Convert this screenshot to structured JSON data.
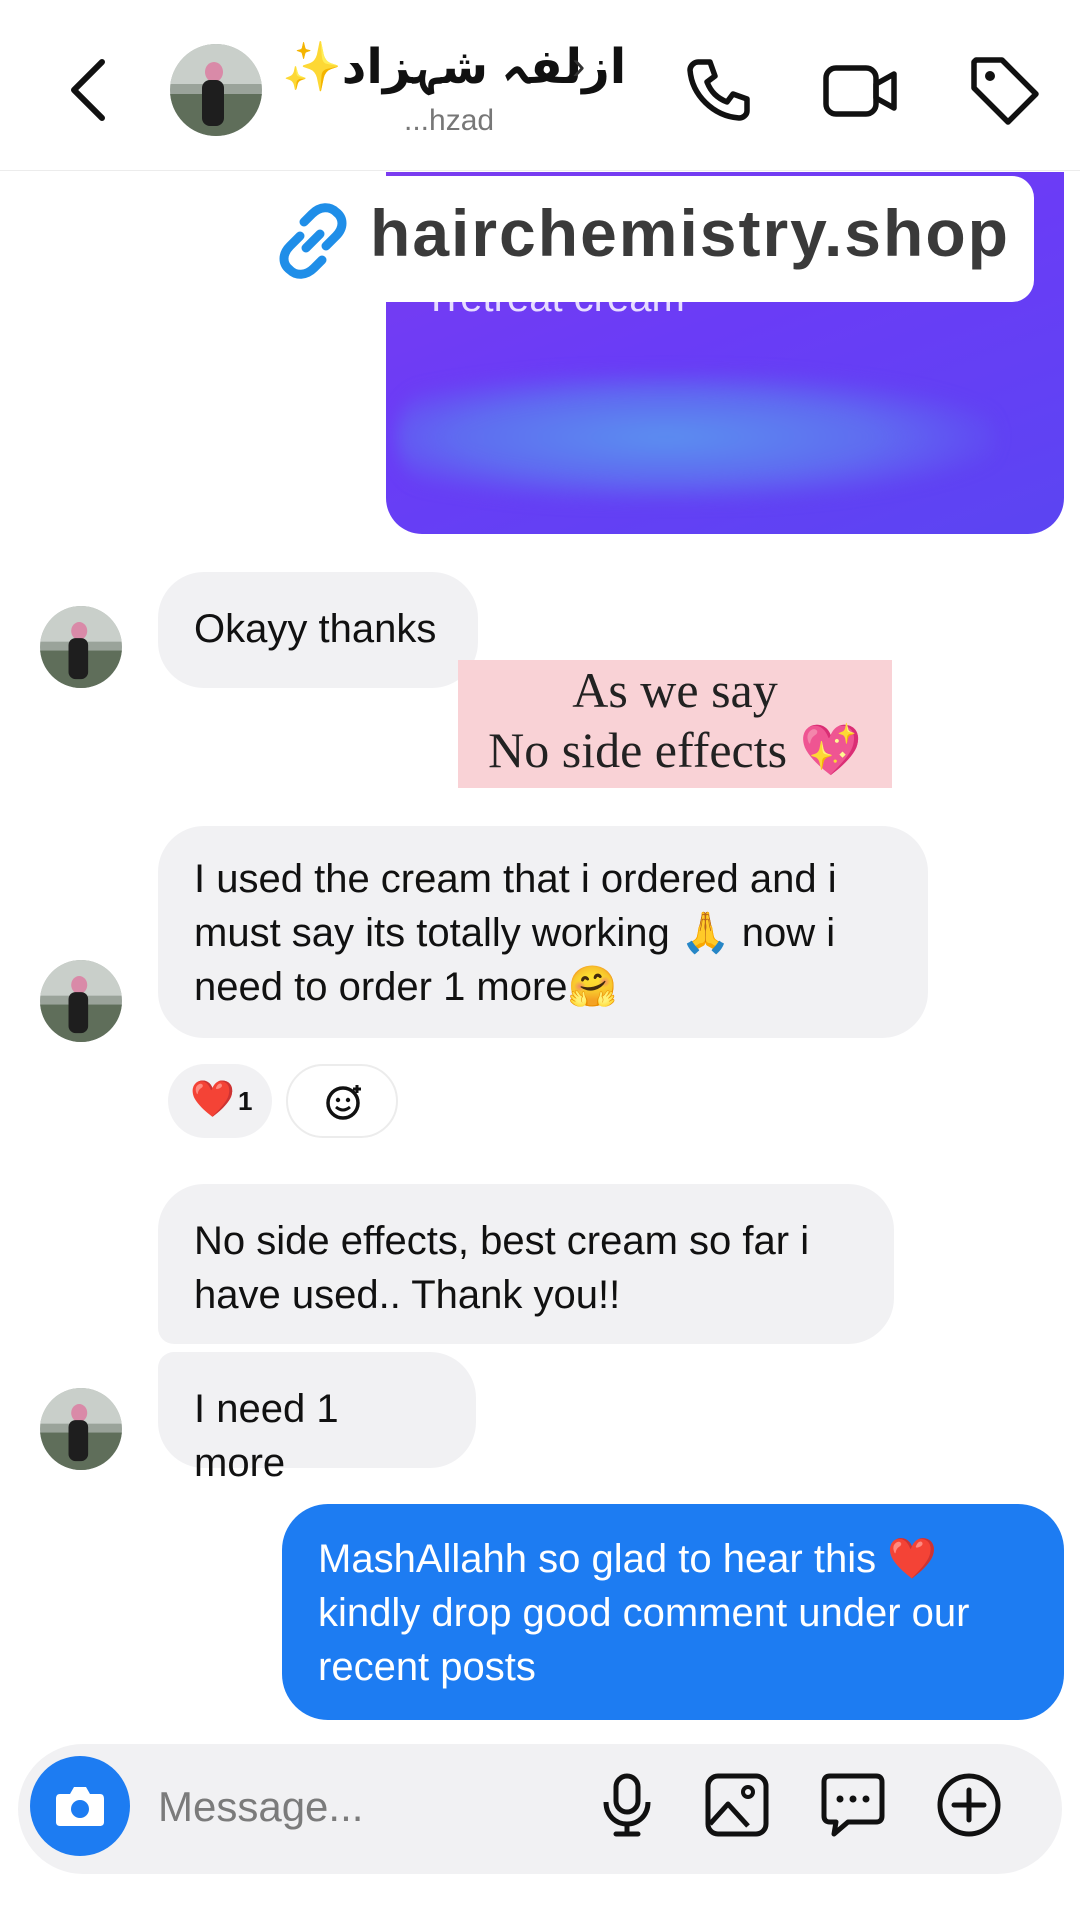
{
  "header": {
    "contact_name": "ازلفہ شہزاد✨",
    "contact_subtitle": "...hzad",
    "icons": [
      "chevron-left-icon",
      "phone-icon",
      "video-camera-icon",
      "tag-icon"
    ]
  },
  "link_overlay": {
    "text": "hairchemistry.shop"
  },
  "shared_card": {
    "caption": "Tretreat cream"
  },
  "messages": {
    "m1": "Okayy thanks",
    "m2": "I used the cream that i ordered and i must say its totally working 🙏 now i need to order 1 more🤗",
    "m3": "No side effects, best cream so far i have used.. Thank you!!",
    "m4": "I need 1 more",
    "m5": "MashAllahh so glad to hear this ❤️ kindly drop good comment under our recent posts"
  },
  "reaction": {
    "emoji": "❤️",
    "count": "1"
  },
  "overlay_caption": {
    "line1": "As we say",
    "line2": "No side effects 💖"
  },
  "composer": {
    "placeholder": "Message..."
  },
  "colors": {
    "my_bubble": "#1d7cf2",
    "their_bubble": "#f1f1f3",
    "card_purple": "#6a3cf6",
    "pink_overlay": "#f9d2d6",
    "link_icon": "#1f8ee8"
  }
}
